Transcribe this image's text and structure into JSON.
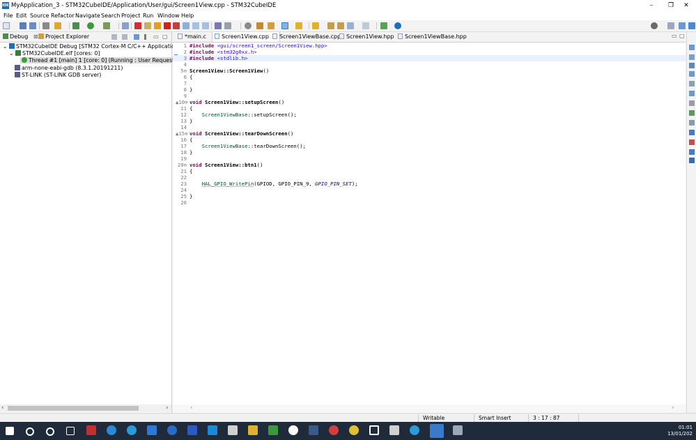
{
  "window": {
    "title": "MyApplication_3 - STM32CubeIDE/Application/User/gui/Screen1View.cpp - STM32CubeIDE",
    "app_icon_text": "IDE",
    "controls": {
      "minimize": "–",
      "restore": "❐",
      "close": "✕"
    }
  },
  "menu": [
    "File",
    "Edit",
    "Source",
    "Refactor",
    "Navigate",
    "Search",
    "Project",
    "Run",
    "Window",
    "Help"
  ],
  "left_panel": {
    "tabs": [
      {
        "label": "Debug",
        "close": "⊠"
      },
      {
        "label": "Project Explorer"
      }
    ],
    "tree": [
      {
        "label": "STM32CubeIDE Debug [STM32 Cortex-M C/C++ Application]",
        "expander": "⌄",
        "icon_color": "#1f6fb8"
      },
      {
        "label": "STM32CubeIDE.elf [cores: 0]",
        "expander": "⌄",
        "icon_color": "#3a7a3a"
      },
      {
        "label": "Thread #1 [main] 1 [core: 0] (Running : User Request)",
        "icon_color": "#3aa03a"
      },
      {
        "label": "arm-none-eabi-gdb (8.3.1.20191211)",
        "icon_color": "#5a5a8a"
      },
      {
        "label": "ST-LINK (ST-LINK GDB server)",
        "icon_color": "#5a5a8a"
      }
    ],
    "scroll_left": "‹",
    "scroll_right": "›"
  },
  "editor": {
    "tabs": [
      {
        "label": "*main.c",
        "active": false
      },
      {
        "label": "Screen1View.cpp",
        "active": true,
        "close": "⊠"
      },
      {
        "label": "Screen1ViewBase.cpp",
        "active": false
      },
      {
        "label": "Screen1View.hpp",
        "active": false
      },
      {
        "label": "Screen1ViewBase.hpp",
        "active": false
      }
    ],
    "lines": [
      {
        "n": "1",
        "t": [
          {
            "c": "kw",
            "s": "#include"
          },
          {
            "c": "",
            "s": " "
          },
          {
            "c": "inc",
            "s": "<gui/screen1_screen/Screen1View.hpp>"
          }
        ]
      },
      {
        "n": "2",
        "t": [
          {
            "c": "kw",
            "s": "#include"
          },
          {
            "c": "",
            "s": " "
          },
          {
            "c": "inc",
            "s": "<stm32g0xx.h>"
          }
        ]
      },
      {
        "n": "3",
        "t": [
          {
            "c": "kw",
            "s": "#include"
          },
          {
            "c": "",
            "s": " "
          },
          {
            "c": "inc",
            "s": "<stdlib.h>"
          }
        ],
        "hl": true
      },
      {
        "n": "4",
        "t": []
      },
      {
        "n": "5⊖",
        "t": [
          {
            "c": "fn",
            "s": "Screen1View::Screen1View"
          },
          {
            "c": "",
            "s": "()"
          }
        ]
      },
      {
        "n": "6",
        "t": [
          {
            "c": "",
            "s": "{"
          }
        ]
      },
      {
        "n": "7",
        "t": []
      },
      {
        "n": "8",
        "t": [
          {
            "c": "",
            "s": "}"
          }
        ]
      },
      {
        "n": "9",
        "t": []
      },
      {
        "n": "▲10⊖",
        "t": [
          {
            "c": "kw",
            "s": "void"
          },
          {
            "c": "",
            "s": " "
          },
          {
            "c": "fn",
            "s": "Screen1View::setupScreen"
          },
          {
            "c": "",
            "s": "()"
          }
        ]
      },
      {
        "n": "11",
        "t": [
          {
            "c": "",
            "s": "{"
          }
        ]
      },
      {
        "n": "12",
        "t": [
          {
            "c": "",
            "s": "    "
          },
          {
            "c": "cls",
            "s": "Screen1ViewBase"
          },
          {
            "c": "",
            "s": "::setupScreen();"
          }
        ]
      },
      {
        "n": "13",
        "t": [
          {
            "c": "",
            "s": "}"
          }
        ]
      },
      {
        "n": "14",
        "t": []
      },
      {
        "n": "▲15⊖",
        "t": [
          {
            "c": "kw",
            "s": "void"
          },
          {
            "c": "",
            "s": " "
          },
          {
            "c": "fn",
            "s": "Screen1View::tearDownScreen"
          },
          {
            "c": "",
            "s": "()"
          }
        ]
      },
      {
        "n": "16",
        "t": [
          {
            "c": "",
            "s": "{"
          }
        ]
      },
      {
        "n": "17",
        "t": [
          {
            "c": "",
            "s": "    "
          },
          {
            "c": "cls",
            "s": "Screen1ViewBase"
          },
          {
            "c": "",
            "s": "::tearDownScreen();"
          }
        ]
      },
      {
        "n": "18",
        "t": [
          {
            "c": "",
            "s": "}"
          }
        ]
      },
      {
        "n": "19",
        "t": []
      },
      {
        "n": "20⊖",
        "t": [
          {
            "c": "kw",
            "s": "void"
          },
          {
            "c": "",
            "s": " "
          },
          {
            "c": "fn",
            "s": "Screen1View::btn1"
          },
          {
            "c": "",
            "s": "()"
          }
        ]
      },
      {
        "n": "21",
        "t": [
          {
            "c": "",
            "s": "{"
          }
        ]
      },
      {
        "n": "22",
        "t": []
      },
      {
        "n": "23",
        "t": [
          {
            "c": "",
            "s": "    "
          },
          {
            "c": "mac",
            "s": "HAL_GPIO_WritePin"
          },
          {
            "c": "",
            "s": "(GPIOD, GPIO_PIN_9, "
          },
          {
            "c": "enum",
            "s": "GPIO_PIN_SET"
          },
          {
            "c": "",
            "s": ");"
          }
        ]
      },
      {
        "n": "24",
        "t": []
      },
      {
        "n": "25",
        "t": [
          {
            "c": "",
            "s": "}"
          }
        ]
      },
      {
        "n": "26",
        "t": []
      }
    ],
    "scroll_left": "‹",
    "scroll_right": "›"
  },
  "status": {
    "writable": "Writable",
    "insert_mode": "Smart Insert",
    "position": "3 : 17 : 87"
  },
  "taskbar": {
    "time": "01:01",
    "date": "13/01/202"
  },
  "colors": {
    "keyword": "#7f0055",
    "include_string": "#2a00ff",
    "class_name": "#005032",
    "enum_constant": "#0000c0",
    "taskbar": "#1f2b3a",
    "highlight_line": "#e8f2fe"
  }
}
